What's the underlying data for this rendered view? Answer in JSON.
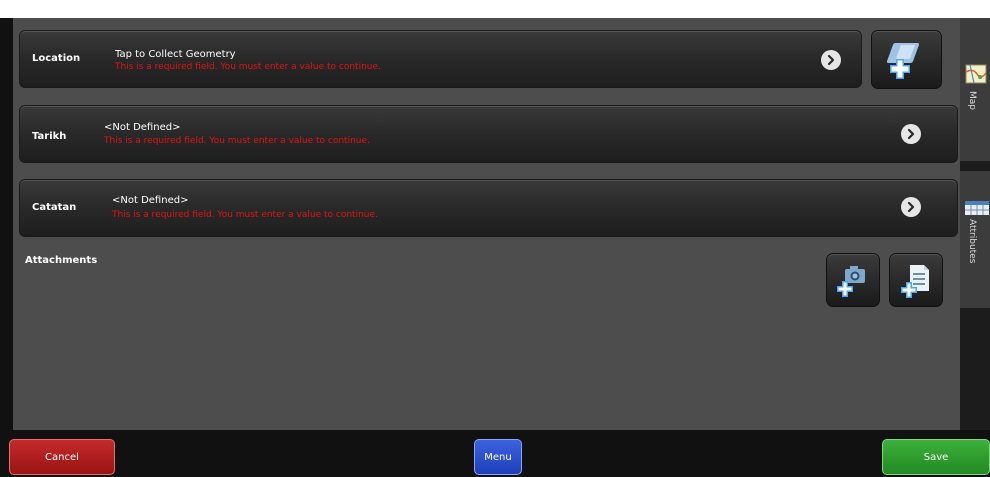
{
  "top_strip": {
    "text": ""
  },
  "fields": [
    {
      "label": "Location",
      "value": "Tap to Collect Geometry",
      "error": "This is a required field. You must enter a value to continue."
    },
    {
      "label": "Tarikh",
      "value": "<Not Defined>",
      "error": "This is a required field. You must enter a value to continue."
    },
    {
      "label": "Catatan",
      "value": "<Not Defined>",
      "error": "This is a required field. You must enter a value to continue."
    }
  ],
  "attachments": {
    "label": "Attachments"
  },
  "side_tabs": {
    "map": "Map",
    "attributes": "Attributes"
  },
  "bottom": {
    "cancel": "Cancel",
    "menu": "Menu",
    "save": "Save"
  },
  "colors": {
    "error": "#e01414",
    "cancel": "#b01e1e",
    "menu": "#2a4fd0",
    "save": "#2e9a2e",
    "panel": "#4d4d4d"
  },
  "icons": {
    "collect_geometry": "add-geometry-icon",
    "add_photo": "camera-add-icon",
    "add_file": "document-add-icon",
    "chevron": "chevron-right-icon"
  }
}
